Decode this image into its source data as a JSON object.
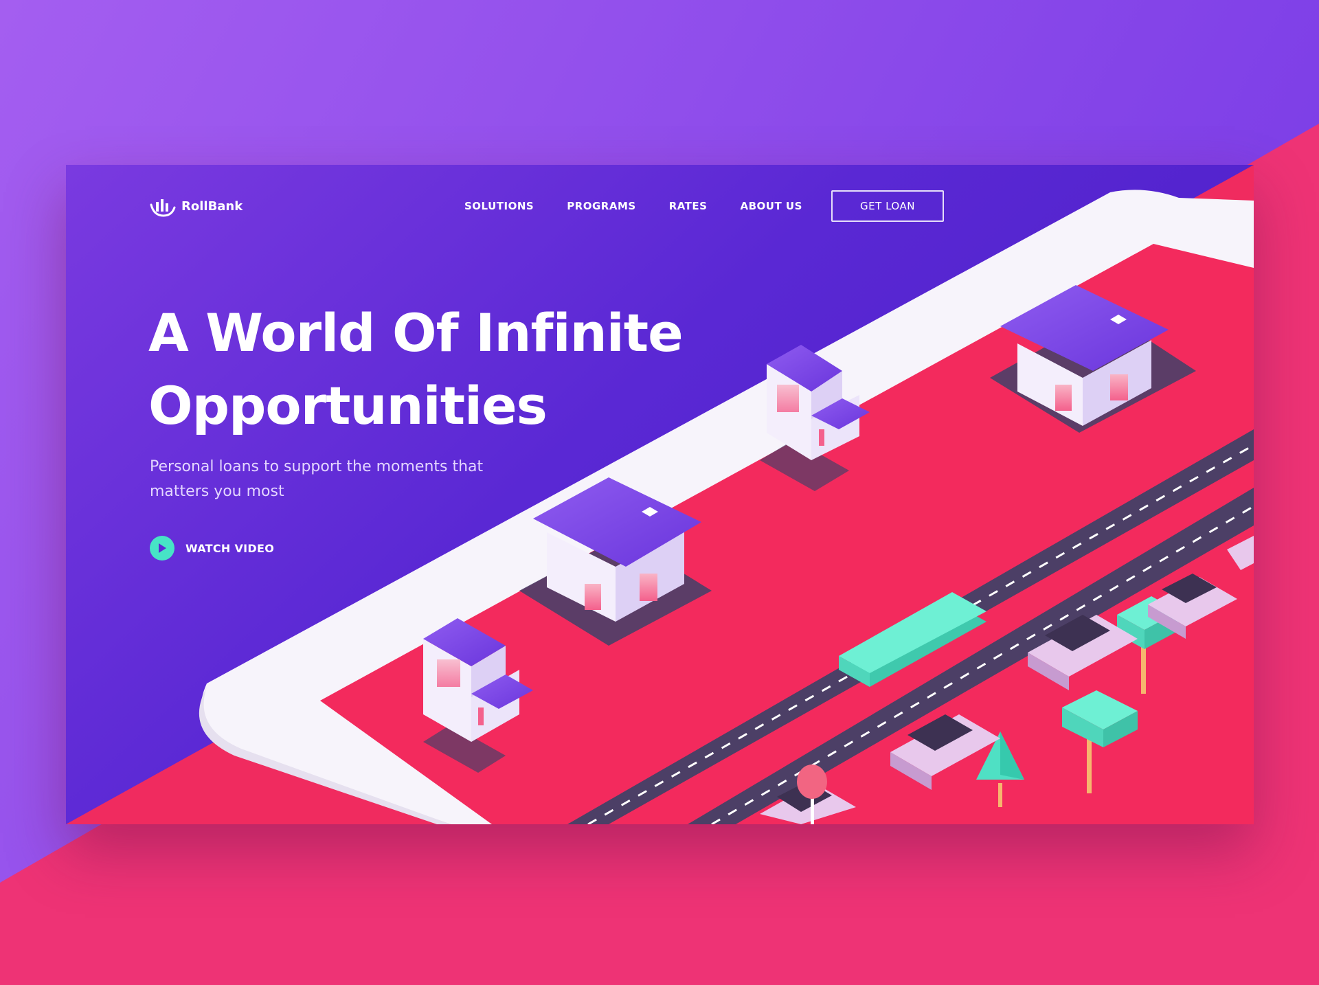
{
  "brand": {
    "name": "RollBank"
  },
  "nav": {
    "links": [
      "SOLUTIONS",
      "PROGRAMS",
      "RATES",
      "ABOUT US"
    ],
    "cta": "GET LOAN"
  },
  "hero": {
    "title": "A World Of Infinite Opportunities",
    "subtitle": "Personal loans to support the moments that matters you most",
    "watch_label": "WATCH VIDEO"
  },
  "colors": {
    "purple_light": "#9b55ec",
    "purple_deep": "#5423d2",
    "pink": "#ee2f6c",
    "teal": "#47e3c6",
    "road": "#4c3f66"
  },
  "icons": {
    "logo": "bar-chart-arc-icon",
    "watch": "play-icon"
  }
}
